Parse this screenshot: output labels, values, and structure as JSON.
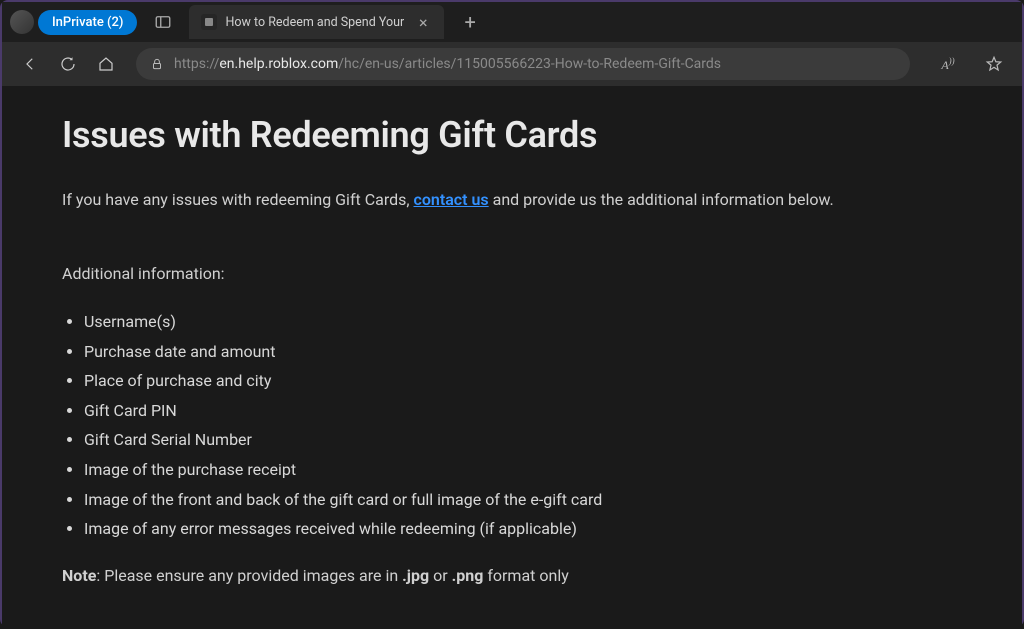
{
  "titlebar": {
    "inprivate_label": "InPrivate (2)",
    "tab_title": "How to Redeem and Spend Your",
    "close_label": "×",
    "new_tab_label": "+"
  },
  "toolbar": {
    "url_protocol": "https://",
    "url_host": "en.help.roblox.com",
    "url_path": "/hc/en-us/articles/115005566223-How-to-Redeem-Gift-Cards",
    "reading_label": "A"
  },
  "content": {
    "heading": "Issues with Redeeming Gift Cards",
    "intro_part1": "If you have any issues with redeeming Gift Cards, ",
    "intro_link": "contact us",
    "intro_part2": " and provide us the additional information below.",
    "additional_label": "Additional information:",
    "list": [
      "Username(s)",
      "Purchase date and amount",
      "Place of purchase and city",
      "Gift Card PIN",
      "Gift Card Serial Number",
      "Image of the purchase receipt",
      "Image of the front and back of the gift card or full image of the e-gift card",
      "Image of any error messages received while redeeming (if applicable)"
    ],
    "note_bold": "Note",
    "note_part1": ": Please ensure any provided images are in ",
    "note_format1": ".jpg",
    "note_or": " or ",
    "note_format2": ".png",
    "note_part2": " format only"
  }
}
